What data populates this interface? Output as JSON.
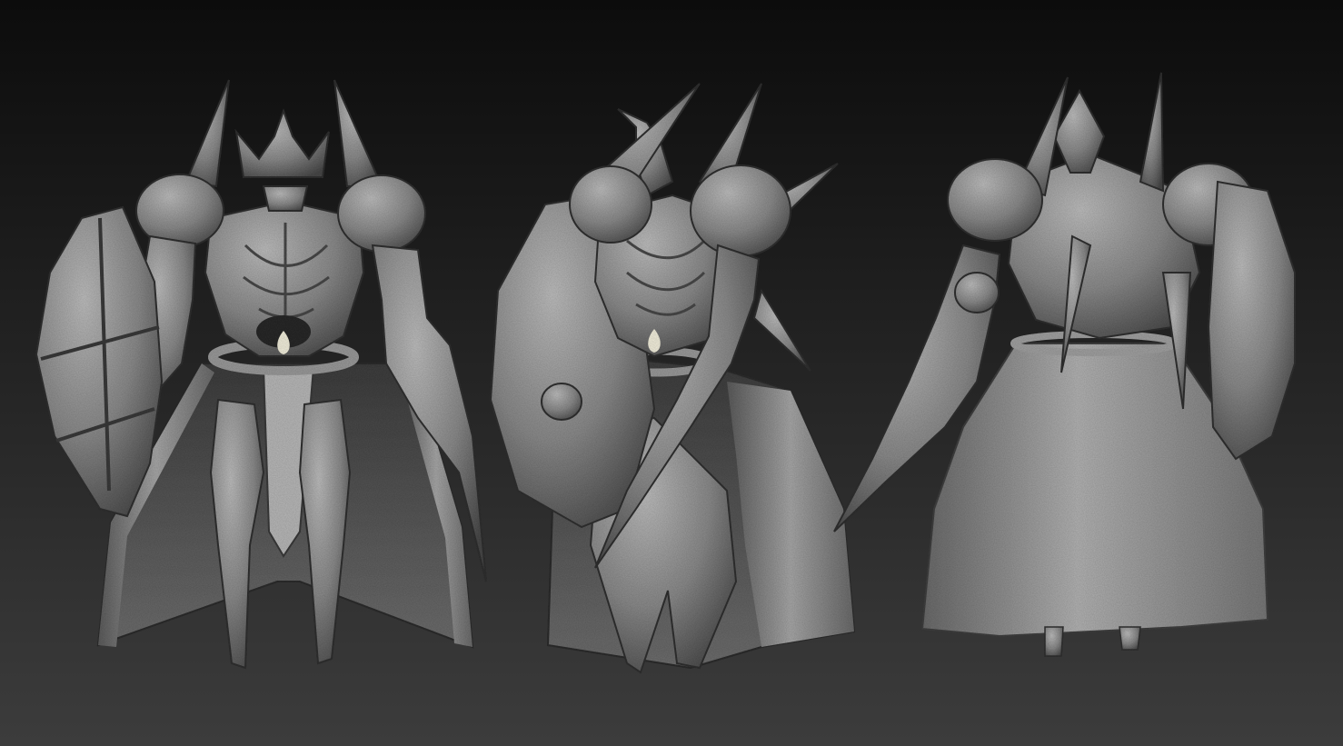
{
  "scene": {
    "kind": "sculpt-viewport-render",
    "subject": "stone-golem-character-turnaround",
    "views": [
      "front",
      "three-quarter",
      "back"
    ]
  },
  "colors": {
    "background_top": "#0c0c0c",
    "background_bottom": "#3c3c3c",
    "clay_light": "#b4b4b4",
    "clay_mid": "#8e8e8e",
    "clay_dark": "#4c4c4c",
    "candle_glow": "#f2eedb"
  }
}
